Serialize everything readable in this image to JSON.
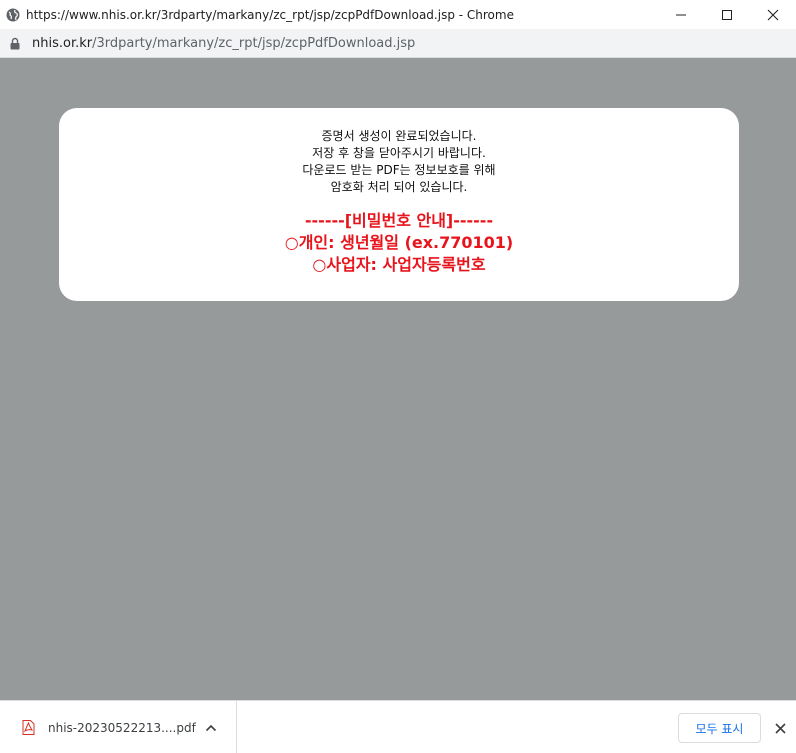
{
  "window": {
    "title": "https://www.nhis.or.kr/3rdparty/markany/zc_rpt/jsp/zcpPdfDownload.jsp - Chrome",
    "icons": [
      "globe-icon",
      "minimize-icon",
      "maximize-icon",
      "close-icon"
    ]
  },
  "address_bar": {
    "domain": "nhis.or.kr",
    "path": "/3rdparty/markany/zc_rpt/jsp/zcpPdfDownload.jsp",
    "icon": "lock-icon"
  },
  "dialog": {
    "lines": [
      "증명서 생성이 완료되었습니다.",
      "저장 후 창을 닫아주시기 바랍니다.",
      "다운로드 받는 PDF는 정보보호를 위해",
      "암호화 처리 되어 있습니다."
    ],
    "password_header": "------[비밀번호 안내]------",
    "password_personal": "○개인: 생년월일 (ex.770101)",
    "password_business": "○사업자: 사업자등록번호",
    "accent_color": "#e8141b"
  },
  "download_shelf": {
    "file_name": "nhis-20230522213....pdf",
    "show_all_label": "모두 표시",
    "icons": [
      "pdf-icon",
      "chevron-up-icon",
      "close-icon"
    ]
  }
}
